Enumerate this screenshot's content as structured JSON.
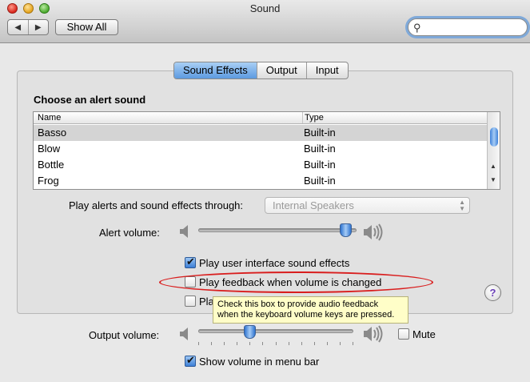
{
  "window": {
    "title": "Sound",
    "back_glyph": "◀",
    "forward_glyph": "▶",
    "show_all_label": "Show All",
    "search_icon": "🔍",
    "search_value": "",
    "search_placeholder": ""
  },
  "tabs": [
    {
      "label": "Sound Effects",
      "active": true
    },
    {
      "label": "Output",
      "active": false
    },
    {
      "label": "Input",
      "active": false
    }
  ],
  "alerts": {
    "heading": "Choose an alert sound",
    "columns": [
      "Name",
      "Type"
    ],
    "rows": [
      {
        "name": "Basso",
        "type": "Built-in",
        "selected": true
      },
      {
        "name": "Blow",
        "type": "Built-in",
        "selected": false
      },
      {
        "name": "Bottle",
        "type": "Built-in",
        "selected": false
      },
      {
        "name": "Frog",
        "type": "Built-in",
        "selected": false
      }
    ],
    "scroll_up": "▲",
    "scroll_down": "▼"
  },
  "play_through": {
    "label": "Play alerts and sound effects through:",
    "value": "Internal Speakers",
    "arrows": "▲▼"
  },
  "alert_volume": {
    "label": "Alert volume:",
    "level_fraction": 0.93,
    "speaker_low": "🔈",
    "speaker_high": "🔊"
  },
  "checkboxes": {
    "ui_sounds": {
      "label": "Play user interface sound effects",
      "checked": true
    },
    "feedback": {
      "label": "Play feedback when volume is changed",
      "checked": false
    },
    "front_row": {
      "label_visible": "Play Front Row sound effects",
      "checked": false
    }
  },
  "help_glyph": "?",
  "tooltip": {
    "line1": "Check this box to provide audio feedback",
    "line2": "when the keyboard volume keys are pressed."
  },
  "output_volume": {
    "label": "Output volume:",
    "level_fraction": 0.33,
    "mute_label": "Mute",
    "mute_checked": false,
    "speaker_low": "🔈",
    "speaker_high": "🔊"
  },
  "menu_bar": {
    "label": "Show volume in menu bar",
    "checked": true
  },
  "colors": {
    "accent": "#5c9ae0",
    "highlight_ring": "#d91e1e",
    "tooltip_bg": "#fffec8"
  }
}
